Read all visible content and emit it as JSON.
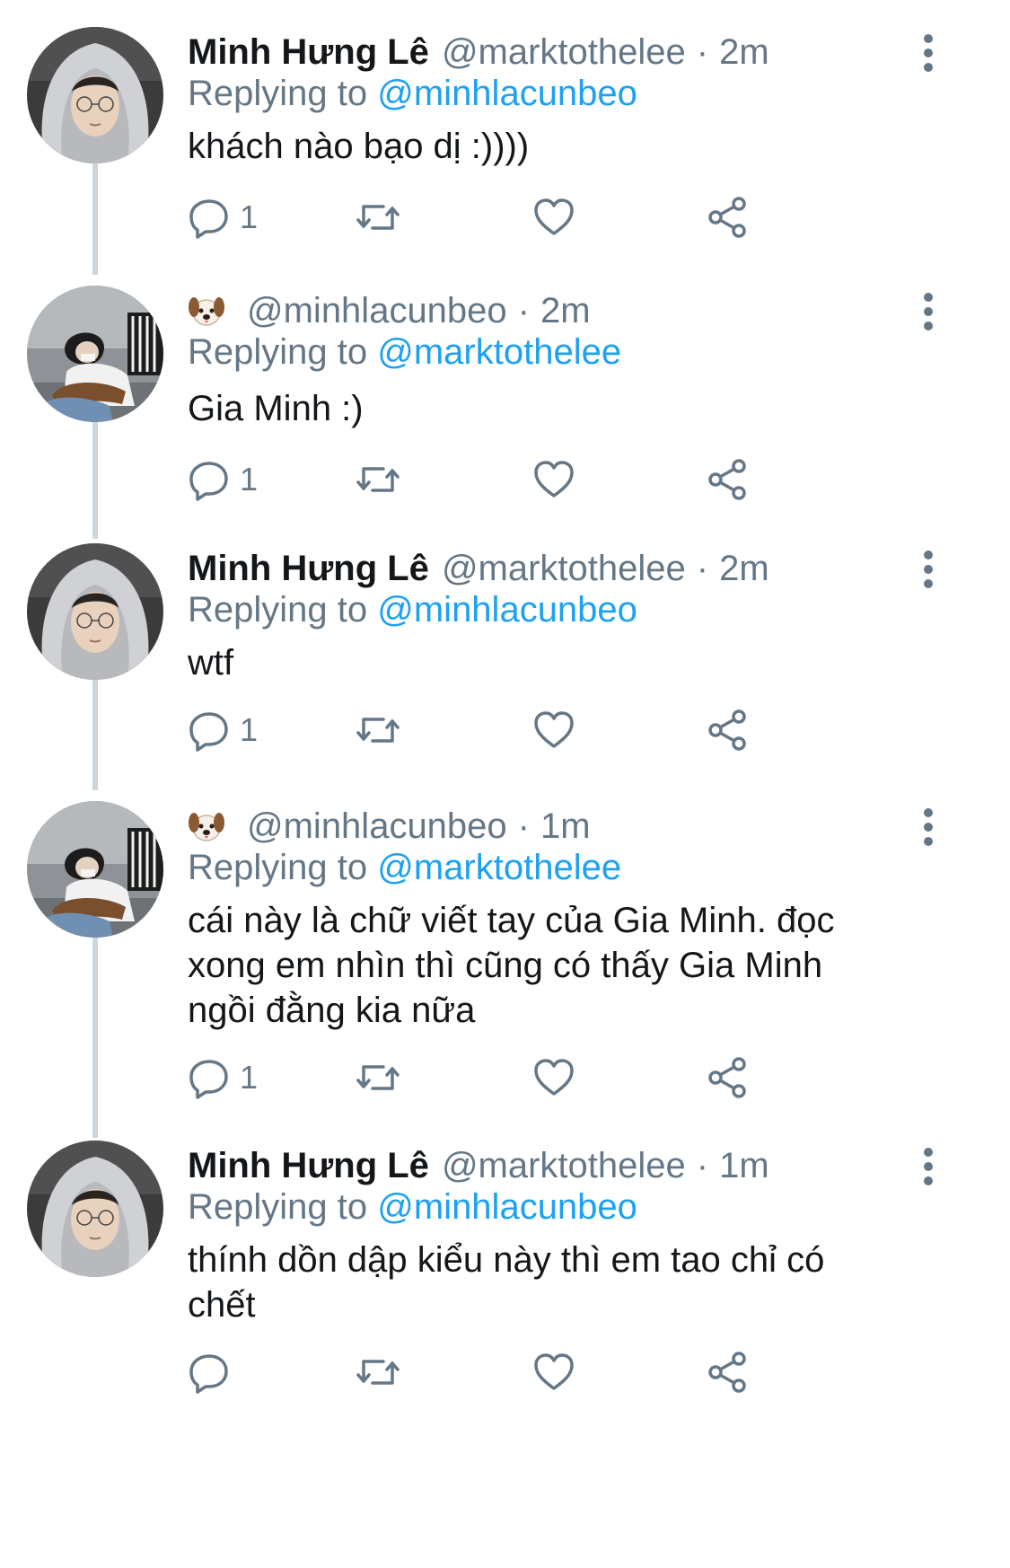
{
  "colors": {
    "link": "#1da1f2",
    "secondary_text": "#657786",
    "primary_text": "#14171a",
    "thread_line": "#ccd6dd"
  },
  "tweets": [
    {
      "display_name": "Minh Hưng Lê",
      "handle": "@marktothelee",
      "dot": "·",
      "time": "2m",
      "reply_prefix": "Replying to",
      "reply_to": "@minhlacunbeo",
      "text": "khách nào bạo dị :))))",
      "reply_count": "1",
      "avatar": "hoodie-avatar"
    },
    {
      "display_name_emoji": "dog-face-icon",
      "handle": "@minhlacunbeo",
      "dot": "·",
      "time": "2m",
      "reply_prefix": "Replying to",
      "reply_to": "@marktothelee",
      "text": "Gia Minh :)",
      "reply_count": "1",
      "avatar": "guitar-avatar"
    },
    {
      "display_name": "Minh Hưng Lê",
      "handle": "@marktothelee",
      "dot": "·",
      "time": "2m",
      "reply_prefix": "Replying to",
      "reply_to": "@minhlacunbeo",
      "text": "wtf",
      "reply_count": "1",
      "avatar": "hoodie-avatar"
    },
    {
      "display_name_emoji": "dog-face-icon",
      "handle": "@minhlacunbeo",
      "dot": "·",
      "time": "1m",
      "reply_prefix": "Replying to",
      "reply_to": "@marktothelee",
      "text_lines": [
        "cái này là chữ viết tay của Gia Minh. đọc",
        "xong em nhìn thì cũng có thấy Gia Minh",
        "ngồi đằng kia nữa"
      ],
      "reply_count": "1",
      "avatar": "guitar-avatar"
    },
    {
      "display_name": "Minh Hưng Lê",
      "handle": "@marktothelee",
      "dot": "·",
      "time": "1m",
      "reply_prefix": "Replying to",
      "reply_to": "@minhlacunbeo",
      "text_lines": [
        "thính dồn dập kiểu này thì em tao chỉ có",
        "chết"
      ],
      "avatar": "hoodie-avatar"
    }
  ]
}
